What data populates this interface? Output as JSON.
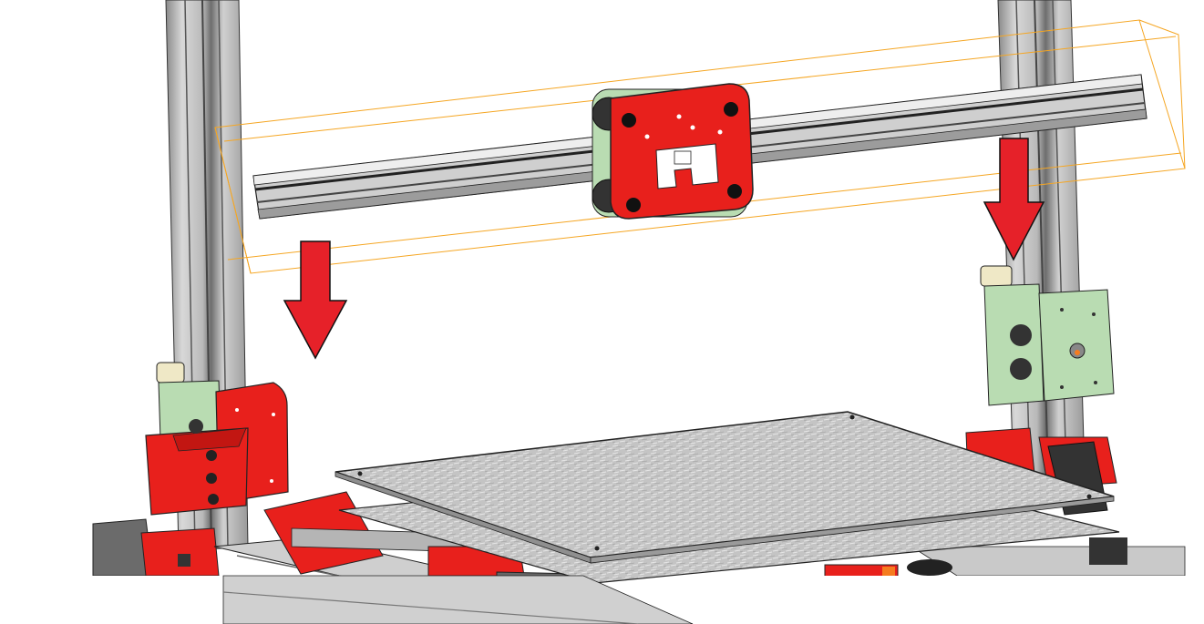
{
  "scene": {
    "subject": "3d-printer-frame-cad-render",
    "parts": [
      "left-vertical-extrusion",
      "right-vertical-extrusion",
      "x-gantry-extrusion",
      "x-carriage-red",
      "left-z-carriage",
      "right-z-carriage",
      "print-bed-plate",
      "print-bed-lower-plate",
      "base-frame"
    ],
    "arrows": [
      {
        "name": "left-down-arrow",
        "direction": "down"
      },
      {
        "name": "right-down-arrow",
        "direction": "down"
      }
    ],
    "colors": {
      "printed_part_red": "#e8201c",
      "printed_part_green": "#b9dcb2",
      "extrusion_silver": "#c9c9c9",
      "extrusion_dark": "#555555",
      "bed_plate": "#bdbdbd",
      "selection_outline": "#f5a623",
      "arrow_red": "#e62129",
      "outline": "#1a1a1a"
    }
  }
}
